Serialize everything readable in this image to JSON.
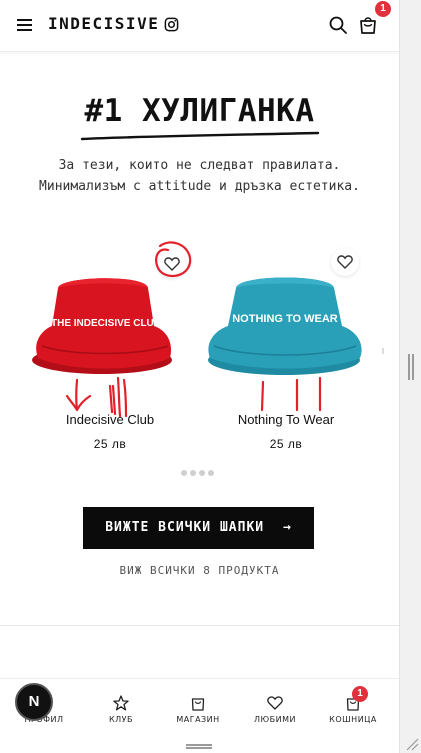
{
  "header": {
    "brand": "INDECISIVE",
    "cart_count": "1",
    "icons": [
      "menu-icon",
      "instagram-icon",
      "search-icon",
      "cart-icon"
    ]
  },
  "hero": {
    "title": "#1 ХУЛИГАНКА",
    "subtitle_line1": "За тези, които не следват правилата.",
    "subtitle_line2": "Минимализъм с attitude и дръзка естетика."
  },
  "products": [
    {
      "name": "Indecisive Club",
      "price": "25 лв",
      "print": "THE INDECISIVE CLUB",
      "color": "#d7141f"
    },
    {
      "name": "Nothing To Wear",
      "price": "25 лв",
      "print": "NOTHING TO WEAR",
      "color": "#2a9fb8"
    }
  ],
  "carousel": {
    "pages": 4,
    "active": 0
  },
  "cta": {
    "label": "ВИЖТЕ ВСИЧКИ ШАПКИ",
    "arrow": "→",
    "link": "ВИЖ ВСИЧКИ 8 ПРОДУКТА"
  },
  "bottom_nav": [
    {
      "label": "ПРОФИЛ",
      "icon": "user-icon"
    },
    {
      "label": "КЛУБ",
      "icon": "star-icon"
    },
    {
      "label": "МАГАЗИН",
      "icon": "bag-icon"
    },
    {
      "label": "ЛЮБИМИ",
      "icon": "heart-icon"
    },
    {
      "label": "КОШНИЦА",
      "icon": "cart-icon",
      "badge": "1"
    }
  ],
  "next_badge": "N",
  "colors": {
    "accent": "#e0313c",
    "annotation": "#e3212b",
    "dark": "#0b0b0b"
  }
}
